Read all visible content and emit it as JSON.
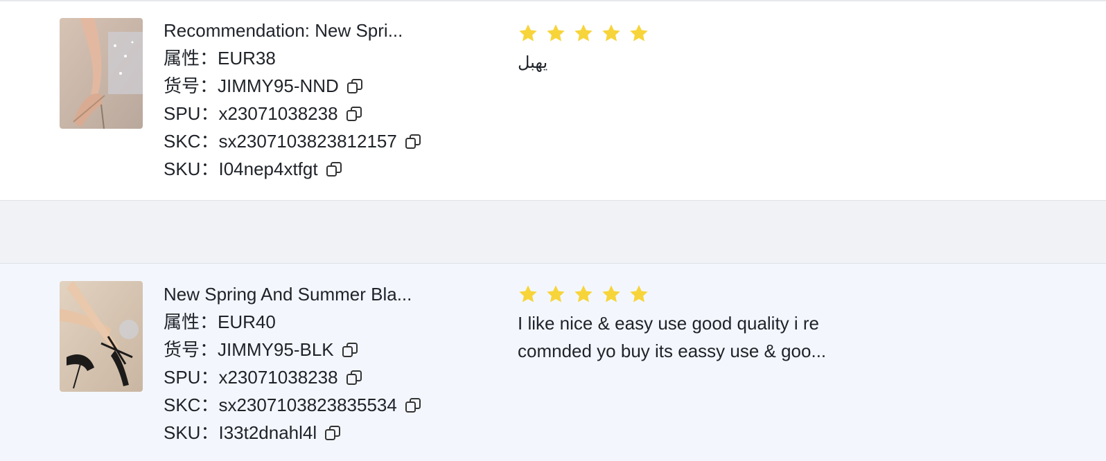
{
  "reviews": [
    {
      "product_title": "Recommendation: New Spri...",
      "attr_label": "属性：",
      "attr_value": "EUR38",
      "item_no_label": "货号：",
      "item_no_value": "JIMMY95-NND",
      "spu_label": "SPU：",
      "spu_value": "x23071038238",
      "skc_label": "SKC：",
      "skc_value": "sx2307103823812157",
      "sku_label": "SKU：",
      "sku_value": "I04nep4xtfgt",
      "rating": 5,
      "review_text": "يهبل"
    },
    {
      "product_title": "New Spring And Summer Bla...",
      "attr_label": "属性：",
      "attr_value": "EUR40",
      "item_no_label": "货号：",
      "item_no_value": "JIMMY95-BLK",
      "spu_label": "SPU：",
      "spu_value": "x23071038238",
      "skc_label": "SKC：",
      "skc_value": "sx2307103823835534",
      "sku_label": "SKU：",
      "sku_value": "I33t2dnahl4l",
      "rating": 5,
      "review_text_line1": "I like nice & easy use good quality i re",
      "review_text_line2": "comnded yo buy its eassy use & goo..."
    }
  ],
  "colors": {
    "star": "#f7d43a",
    "row_alt_bg": "#f3f7fd",
    "spacer_bg": "#f0f2f5",
    "text": "#1f2329"
  },
  "icons": {
    "copy": "copy-icon",
    "star": "star-icon",
    "thumbnail": "product-thumbnail"
  }
}
